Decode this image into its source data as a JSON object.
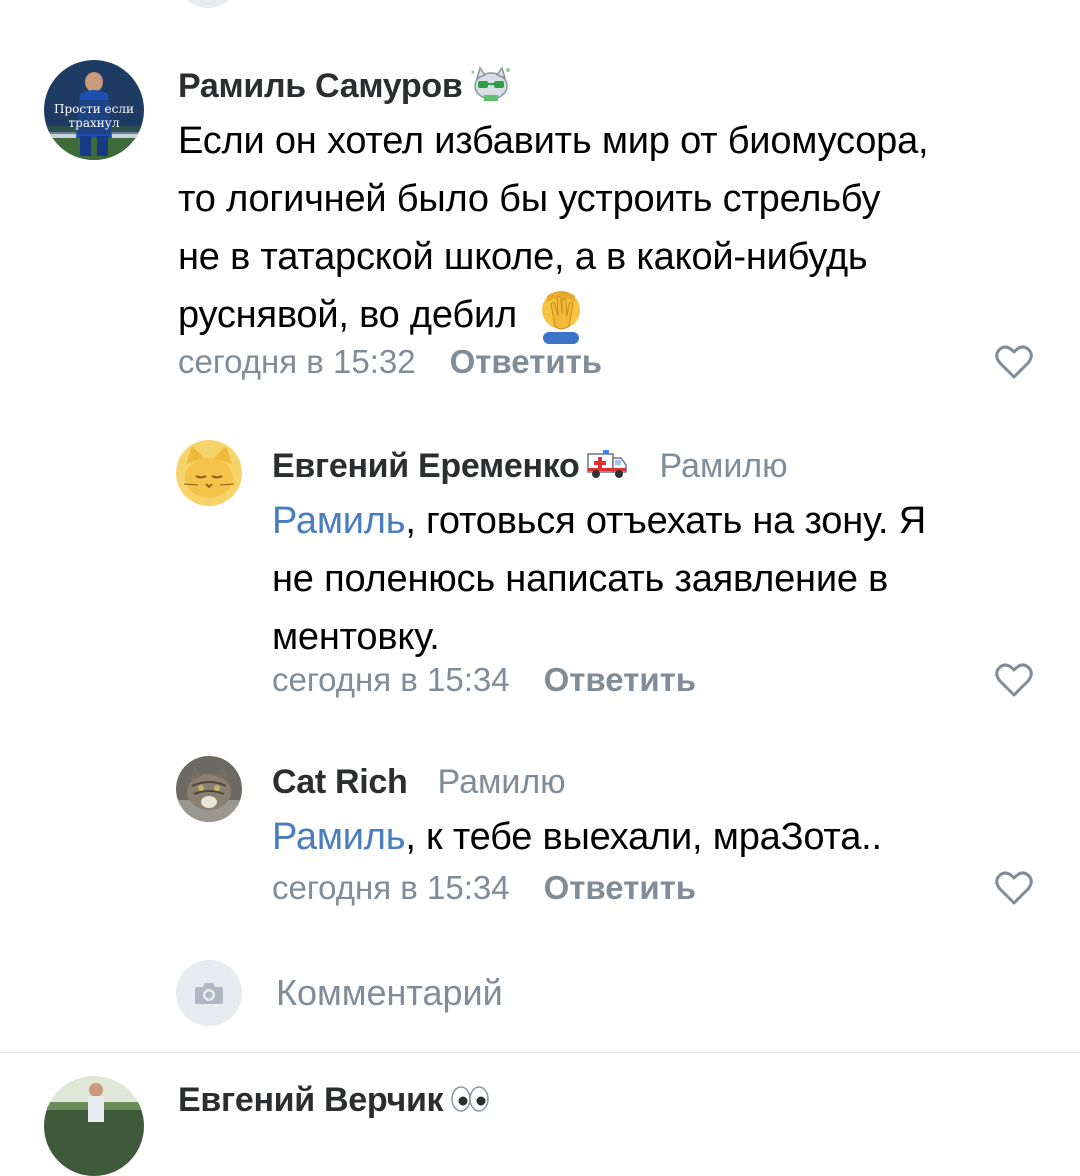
{
  "comments": [
    {
      "author": "Рамиль Самуров",
      "author_badge_icon": "glasses-cat-sticker-icon",
      "avatar_text_line1": "Прости если",
      "avatar_text_line2": "трахнул",
      "text_lines": [
        "Если он хотел избавить мир от биомусора,",
        "то логичней было бы устроить стрельбу",
        "не в татарской школе, а в какой-нибудь",
        "руснявой, во дебил"
      ],
      "text_emoji_icon": "facepalm-icon",
      "time": "сегодня в 15:32",
      "reply_label": "Ответить"
    },
    {
      "author": "Евгений Еременко",
      "author_badge_icon": "ambulance-icon",
      "reply_to": "Рамилю",
      "mention": "Рамиль",
      "text_first_rest": ", готовься отъехать на зону. Я",
      "text_lines": [
        "не поленюсь написать заявление в",
        "ментовку."
      ],
      "time": "сегодня в 15:34",
      "reply_label": "Ответить"
    },
    {
      "author": "Cat Rich",
      "reply_to": "Рамилю",
      "mention": "Рамиль",
      "text_rest": ", к тебе выехали, мраЗота..",
      "time": "сегодня в 15:34",
      "reply_label": "Ответить"
    }
  ],
  "compose": {
    "placeholder": "Комментарий",
    "camera_icon": "camera-icon"
  },
  "next_comment": {
    "author": "Евгений Верчик",
    "author_badge_icon": "eyes-icon"
  },
  "colors": {
    "link": "#4a7cc0",
    "secondary": "#818c99",
    "name": "#2c2d2e"
  }
}
